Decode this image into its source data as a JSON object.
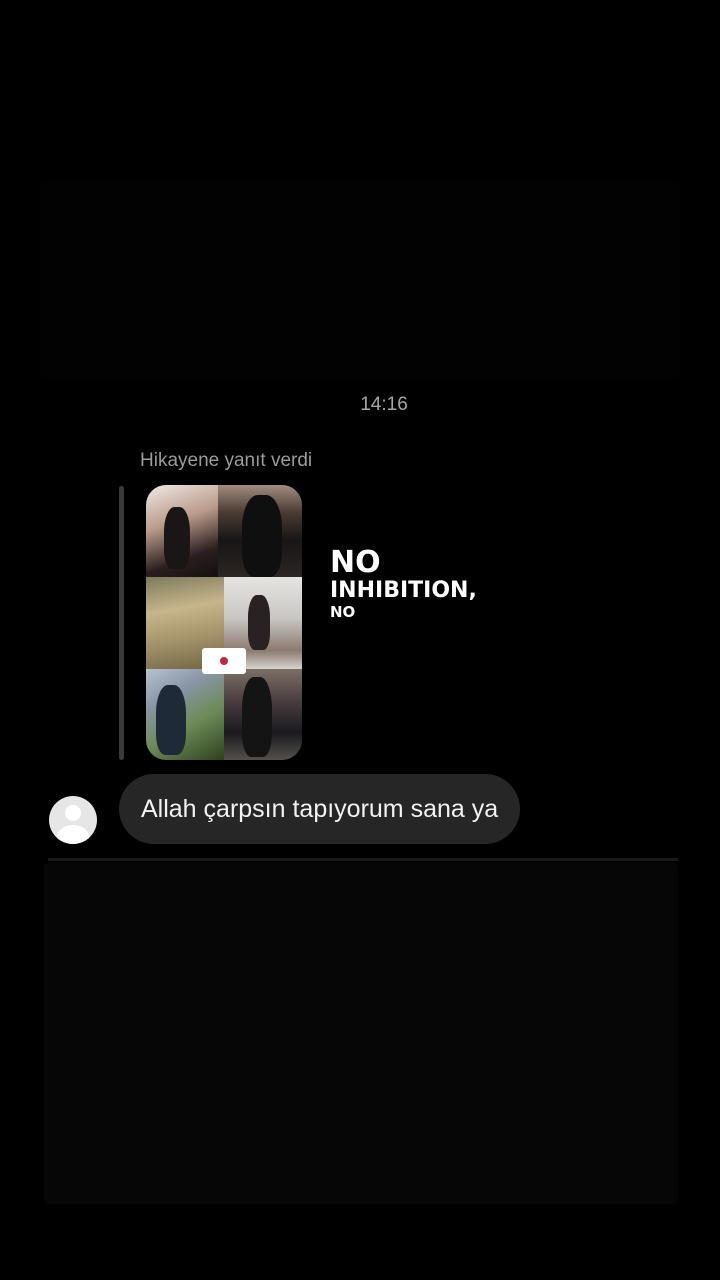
{
  "chat": {
    "timestamp": "14:16",
    "reply_context_label": "Hikayene yanıt verdi",
    "story_preview": {
      "overlay_text": [
        "NO",
        "INHIBITION,",
        "NO"
      ]
    },
    "message": {
      "text": "Allah çarpsın tapıyorum sana ya"
    }
  },
  "colors": {
    "background": "#000000",
    "bubble": "#262626",
    "timestamp_text": "#a6a6a6",
    "label_text": "#9b9b9b",
    "avatar": "#e6e6e6"
  },
  "icons": {
    "avatar": "default-user-avatar-icon"
  }
}
